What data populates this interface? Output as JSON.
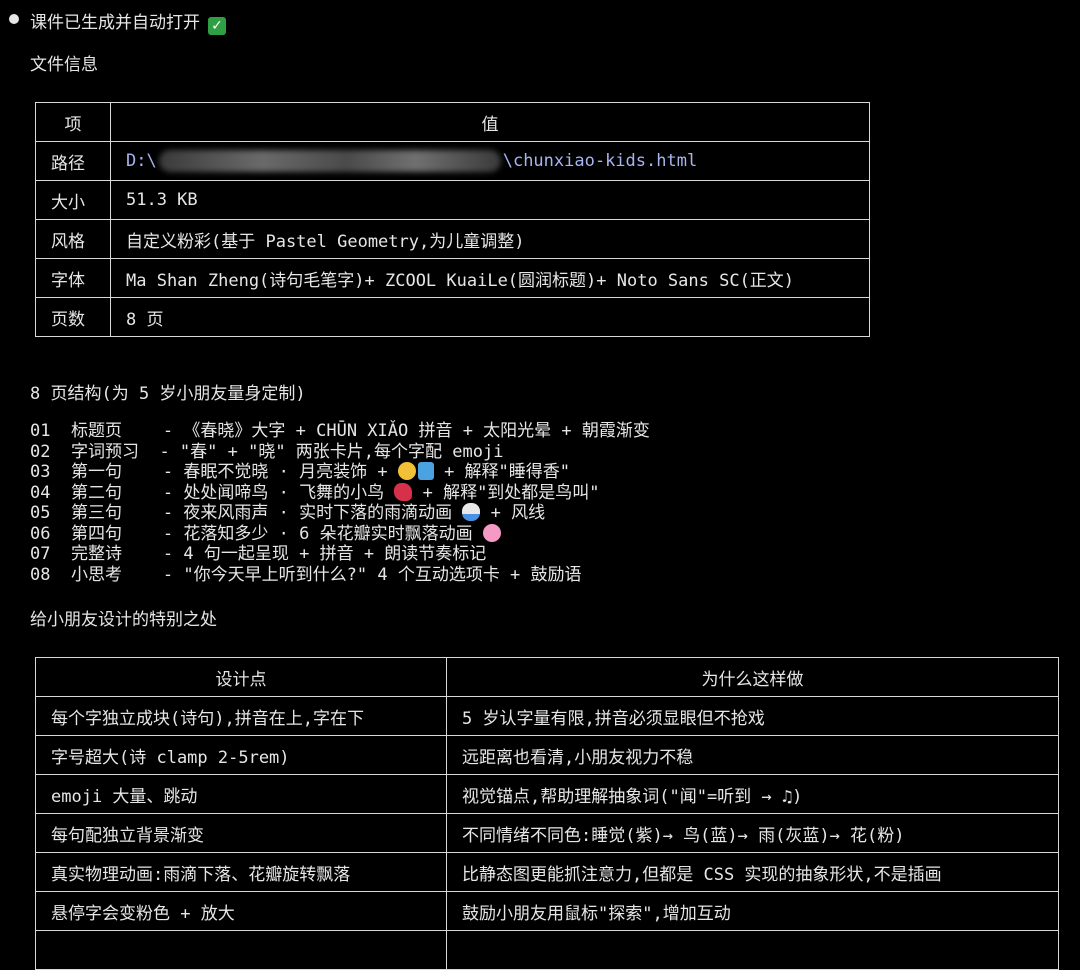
{
  "status": {
    "text": "课件已生成并自动打开",
    "icon": "check-icon",
    "icon_color": "#2ea043"
  },
  "file_info": {
    "heading": "文件信息",
    "headers": [
      "项",
      "值"
    ],
    "rows": [
      {
        "key": "路径",
        "value_prefix": "D:\\",
        "value_suffix": "\\chunxiao-kids.html"
      },
      {
        "key": "大小",
        "value": "51.3 KB"
      },
      {
        "key": "风格",
        "value": "自定义粉彩(基于 Pastel Geometry,为儿童调整)"
      },
      {
        "key": "字体",
        "value": "Ma Shan Zheng(诗句毛笔字)+ ZCOOL KuaiLe(圆润标题)+ Noto Sans SC(正文)"
      },
      {
        "key": "页数",
        "value": "8 页"
      }
    ]
  },
  "structure": {
    "heading": "8 页结构(为 5 岁小朋友量身定制)",
    "items": [
      {
        "num": "01",
        "name": "标题页  ",
        "desc": "《春晓》大字 + CHŪN XIǍO 拼音 + 太阳光晕 + 朝霞渐变"
      },
      {
        "num": "02",
        "name": "字词预习",
        "desc": "\"春\" + \"晓\" 两张卡片,每个字配 emoji"
      },
      {
        "num": "03",
        "name": "第一句  ",
        "desc": "春眠不觉晓 · 月亮装饰 + ",
        "emoji": [
          "sleeping-face-icon",
          "zzz-icon"
        ],
        "desc_after": " + 解释\"睡得香\""
      },
      {
        "num": "04",
        "name": "第二句  ",
        "desc": "处处闻啼鸟 · 飞舞的小鸟 ",
        "emoji": [
          "bird-icon"
        ],
        "desc_after": " + 解释\"到处都是鸟叫\""
      },
      {
        "num": "05",
        "name": "第三句  ",
        "desc": "夜来风雨声 · 实时下落的雨滴动画 ",
        "emoji": [
          "rain-cloud-icon"
        ],
        "desc_after": " + 风线"
      },
      {
        "num": "06",
        "name": "第四句  ",
        "desc": "花落知多少 · 6 朵花瓣实时飘落动画 ",
        "emoji": [
          "cherry-blossom-icon"
        ],
        "desc_after": ""
      },
      {
        "num": "07",
        "name": "完整诗  ",
        "desc": "4 句一起呈现 + 拼音 + 朗读节奏标记"
      },
      {
        "num": "08",
        "name": "小思考  ",
        "desc": "\"你今天早上听到什么?\" 4 个互动选项卡 + 鼓励语"
      }
    ]
  },
  "design": {
    "heading": "给小朋友设计的特别之处",
    "headers": [
      "设计点",
      "为什么这样做"
    ],
    "rows": [
      [
        "每个字独立成块(诗句),拼音在上,字在下",
        "5 岁认字量有限,拼音必须显眼但不抢戏"
      ],
      [
        "字号超大(诗 clamp 2-5rem)",
        "远距离也看清,小朋友视力不稳"
      ],
      [
        "emoji 大量、跳动",
        "视觉锚点,帮助理解抽象词(\"闻\"=听到 → ♫)"
      ],
      [
        "每句配独立背景渐变",
        "不同情绪不同色:睡觉(紫)→ 鸟(蓝)→ 雨(灰蓝)→ 花(粉)"
      ],
      [
        "真实物理动画:雨滴下落、花瓣旋转飘落",
        "比静态图更能抓注意力,但都是 CSS 实现的抽象形状,不是插画"
      ],
      [
        "悬停字会变粉色 + 放大",
        "鼓励小朋友用鼠标\"探索\",增加互动"
      ]
    ]
  }
}
